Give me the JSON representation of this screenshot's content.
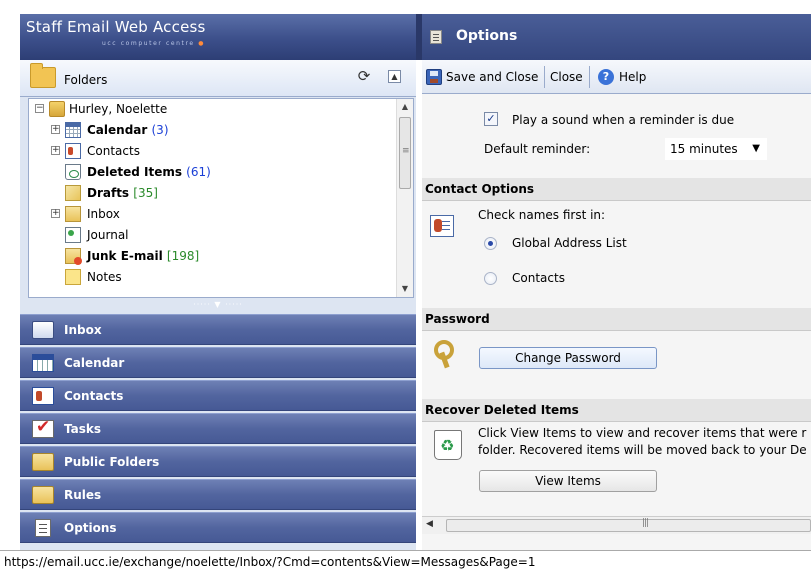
{
  "app": {
    "title": "Staff Email Web Access",
    "subtitle": "ucc computer centre"
  },
  "folders_panel": {
    "header": "Folders",
    "tree": [
      {
        "label": "Hurley, Noelette",
        "count": "",
        "bold": false,
        "expander": "minus",
        "icon": "mailbox-icon"
      },
      {
        "label": "Calendar",
        "count": "(3)",
        "bold": true,
        "expander": "plus",
        "icon": "calendar-icon"
      },
      {
        "label": "Contacts",
        "count": "",
        "bold": false,
        "expander": "plus",
        "icon": "contacts-icon"
      },
      {
        "label": "Deleted Items",
        "count": "(61)",
        "bold": true,
        "expander": "",
        "icon": "deleted-items-icon"
      },
      {
        "label": "Drafts",
        "count": "[35]",
        "bold": true,
        "expander": "",
        "icon": "drafts-icon"
      },
      {
        "label": "Inbox",
        "count": "",
        "bold": false,
        "expander": "plus",
        "icon": "inbox-folder-icon"
      },
      {
        "label": "Journal",
        "count": "",
        "bold": false,
        "expander": "",
        "icon": "journal-icon"
      },
      {
        "label": "Junk E-mail",
        "count": "[198]",
        "bold": true,
        "expander": "",
        "icon": "junk-email-icon"
      },
      {
        "label": "Notes",
        "count": "",
        "bold": false,
        "expander": "",
        "icon": "notes-icon"
      }
    ]
  },
  "nav": [
    {
      "label": "Inbox",
      "icon": "inbox-icon"
    },
    {
      "label": "Calendar",
      "icon": "calendar-icon"
    },
    {
      "label": "Contacts",
      "icon": "contacts-icon"
    },
    {
      "label": "Tasks",
      "icon": "tasks-icon"
    },
    {
      "label": "Public Folders",
      "icon": "public-folders-icon"
    },
    {
      "label": "Rules",
      "icon": "rules-icon"
    },
    {
      "label": "Options",
      "icon": "options-icon"
    }
  ],
  "options": {
    "title": "Options",
    "toolbar": {
      "save_close": "Save and Close",
      "close": "Close",
      "help": "Help"
    },
    "reminder": {
      "checkbox_label": "Play a sound when a reminder is due",
      "checked": true,
      "default_label": "Default reminder:",
      "default_value": "15 minutes"
    },
    "contact_options": {
      "header": "Contact Options",
      "check_first": "Check names first in:",
      "radio_gal": "Global Address List",
      "radio_contacts": "Contacts",
      "selected": "Global Address List"
    },
    "password": {
      "header": "Password",
      "button": "Change Password"
    },
    "recover": {
      "header": "Recover Deleted Items",
      "line1": "Click View Items to view and recover items that were r",
      "line2": "folder. Recovered items will be moved back to your De",
      "button": "View Items"
    }
  },
  "status_bar": {
    "url": "https://email.ucc.ie/exchange/noelette/Inbox/?Cmd=contents&View=Messages&Page=1"
  }
}
